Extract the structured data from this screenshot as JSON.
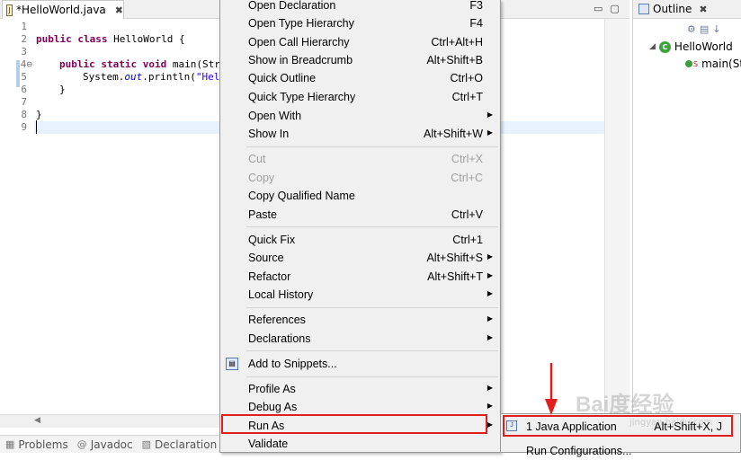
{
  "editor": {
    "tab_title": "*HelloWorld.java",
    "tab_close": "✖",
    "line_numbers": [
      "1",
      "2",
      "3",
      "4⊖",
      "5",
      "6",
      "7",
      "8",
      "9"
    ],
    "code": {
      "l2_kw": "public class",
      "l2_rest": " HelloWorld {",
      "l4_kw": "public static void",
      "l4_rest": " main(Str",
      "l5_pre": "System.",
      "l5_field": "out",
      "l5_mid": ".println(",
      "l5_str": "\"Hel",
      "l6": "}",
      "l8": "}"
    }
  },
  "outline": {
    "title": "Outline",
    "close": "✖",
    "class_name": "HelloWorld",
    "method_name": "main(St",
    "static_marker": "S"
  },
  "bottom_tabs": [
    "Problems",
    "Javadoc",
    "Declaration"
  ],
  "context_menu": {
    "items": [
      {
        "label": "Open Declaration",
        "shortcut": "F3"
      },
      {
        "label": "Open Type Hierarchy",
        "shortcut": "F4"
      },
      {
        "label": "Open Call Hierarchy",
        "shortcut": "Ctrl+Alt+H"
      },
      {
        "label": "Show in Breadcrumb",
        "shortcut": "Alt+Shift+B"
      },
      {
        "label": "Quick Outline",
        "shortcut": "Ctrl+O"
      },
      {
        "label": "Quick Type Hierarchy",
        "shortcut": "Ctrl+T"
      },
      {
        "label": "Open With",
        "shortcut": ""
      },
      {
        "label": "Show In",
        "shortcut": "Alt+Shift+W"
      },
      {
        "label": "Cut",
        "shortcut": "Ctrl+X"
      },
      {
        "label": "Copy",
        "shortcut": "Ctrl+C"
      },
      {
        "label": "Copy Qualified Name",
        "shortcut": ""
      },
      {
        "label": "Paste",
        "shortcut": "Ctrl+V"
      },
      {
        "label": "Quick Fix",
        "shortcut": "Ctrl+1"
      },
      {
        "label": "Source",
        "shortcut": "Alt+Shift+S"
      },
      {
        "label": "Refactor",
        "shortcut": "Alt+Shift+T"
      },
      {
        "label": "Local History",
        "shortcut": ""
      },
      {
        "label": "References",
        "shortcut": ""
      },
      {
        "label": "Declarations",
        "shortcut": ""
      },
      {
        "label": "Add to Snippets...",
        "shortcut": ""
      },
      {
        "label": "Profile As",
        "shortcut": ""
      },
      {
        "label": "Debug As",
        "shortcut": ""
      },
      {
        "label": "Run As",
        "shortcut": ""
      },
      {
        "label": "Validate",
        "shortcut": ""
      }
    ],
    "arrow": "▶"
  },
  "submenu": {
    "items": [
      {
        "label": "1 Java Application",
        "shortcut": "Alt+Shift+X, J"
      },
      {
        "label": "Run Configurations...",
        "shortcut": ""
      }
    ]
  },
  "watermark": {
    "text": "Bai度经验",
    "url": "jingyan.baidu.com"
  },
  "colors": {
    "highlight_red": "#e11d1d",
    "keyword": "#7f0055",
    "string": "#2a00ff"
  }
}
